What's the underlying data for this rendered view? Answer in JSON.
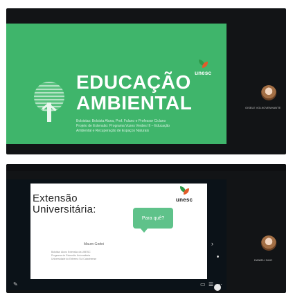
{
  "top": {
    "slide": {
      "title_line1": "EDUCAÇÃO",
      "title_line2": "AMBIENTAL",
      "subtitle_lines": [
        "Bolsistas: Bolsista Aluna, Prof. Fulano e Professor Ciclano",
        "Projeto de Extensão: Programa Vozes Verdes III – Educação",
        "Ambiental e Recuperação de Espaços Naturais"
      ],
      "logo_text": "unesc"
    },
    "participant": {
      "name": "GISELE VOLKOVENHANTE"
    },
    "colors": {
      "slide_bg": "#3fb56b",
      "frame_bg": "#121416"
    }
  },
  "bottom": {
    "slide": {
      "title_line1": "Extensão",
      "title_line2": "Universitária:",
      "bubble_text": "Para quê?",
      "presenter_name": "Mauro Godoi",
      "footer_lines": [
        "Bolsista: Aluno Extensão da UNESC",
        "Programa de Extensão Universitária",
        "Universidade do Extremo Sul Catarinense"
      ],
      "logo_text": "unesc"
    },
    "participant": {
      "name": "DANIELI IVAO"
    },
    "icons": [
      "pointer-icon",
      "present-icon",
      "captions-icon",
      "more-icon"
    ],
    "colors": {
      "slide_bg": "#ffffff",
      "bubble_bg": "#5fc28a"
    }
  }
}
